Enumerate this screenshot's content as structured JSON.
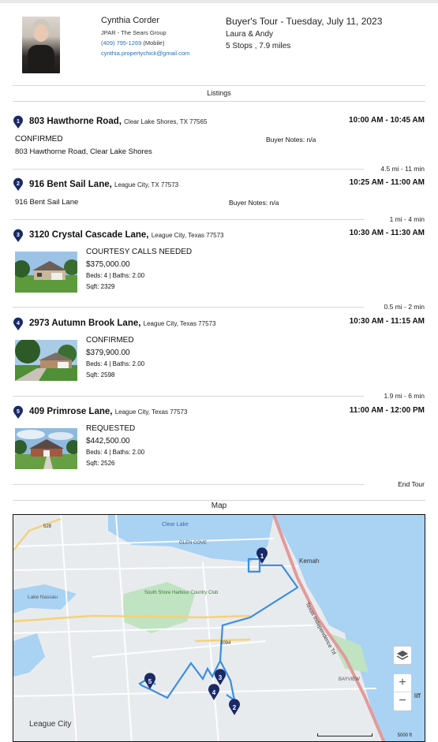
{
  "agent": {
    "name": "Cynthia Corder",
    "company": "JPAR - The Sears Group",
    "phone": "(409) 795-1269",
    "phone_type": "(Mobile)",
    "email": "cynthia.propertychick@gmail.com"
  },
  "tour": {
    "title": "Buyer's Tour - Tuesday, July 11, 2023",
    "clients": "Laura & Andy",
    "summary": "5 Stops , 7.9 miles"
  },
  "sections": {
    "listings": "Listings",
    "map": "Map",
    "end_tour": "End Tour"
  },
  "stops": [
    {
      "number": "1",
      "street": "803 Hawthorne Road,",
      "city": "Clear Lake Shores, TX 77565",
      "time": "10:00 AM - 10:45 AM",
      "status": "CONFIRMED",
      "description": "803 Hawthorne Road, Clear Lake Shores",
      "notes": "Buyer Notes: n/a"
    },
    {
      "number": "2",
      "street": "916 Bent Sail Lane,",
      "city": "League City, TX 77573",
      "time": "10:25 AM - 11:00 AM",
      "description": "916 Bent Sail Lane",
      "notes": "Buyer Notes: n/a",
      "distance": "4.5 mi - 11 min"
    },
    {
      "number": "3",
      "street": "3120 Crystal Cascade Lane,",
      "city": "League City, Texas 77573",
      "time": "10:30 AM - 11:30 AM",
      "status": "COURTESY CALLS NEEDED",
      "price": "$375,000.00",
      "beds_baths": "Beds: 4 | Baths: 2.00",
      "sqft": "Sqft: 2329",
      "distance": "1 mi - 4 min"
    },
    {
      "number": "4",
      "street": "2973 Autumn Brook Lane,",
      "city": "League City, Texas 77573",
      "time": "10:30 AM - 11:15 AM",
      "status": "CONFIRMED",
      "price": "$379,900.00",
      "beds_baths": "Beds: 4 | Baths: 2.00",
      "sqft": "Sqft: 2598",
      "distance": "0.5 mi - 2 min"
    },
    {
      "number": "5",
      "street": "409 Primrose Lane,",
      "city": "League City, Texas 77573",
      "time": "11:00 AM - 12:00 PM",
      "status": "REQUESTED",
      "price": "$442,500.00",
      "beds_baths": "Beds: 4 | Baths: 2.00",
      "sqft": "Sqft: 2526",
      "distance": "1.9 mi - 6 min"
    }
  ],
  "map": {
    "labels": {
      "clear_lake": "Clear Lake",
      "glen_cove": "GLEN COVE",
      "kemah": "Kemah",
      "lake_nassau": "Lake Nassau",
      "golf": "South Shore Harbour Country Club",
      "independence_trail": "Texas Independence Trl",
      "bayview": "BAYVIEW",
      "league_city": "League City",
      "highway_528": "528",
      "highway_2094": "2094",
      "cliff": "liff",
      "scale": "5000 ft"
    },
    "controls": {
      "layers": "layers-icon",
      "zoom_in": "+",
      "zoom_out": "−"
    },
    "colors": {
      "route": "#3b8de3",
      "water": "#a8d1f3",
      "land": "#e9ecef",
      "park": "#bfe2bf",
      "pin": "#1a2a66",
      "highway": "#e08a8a"
    }
  }
}
